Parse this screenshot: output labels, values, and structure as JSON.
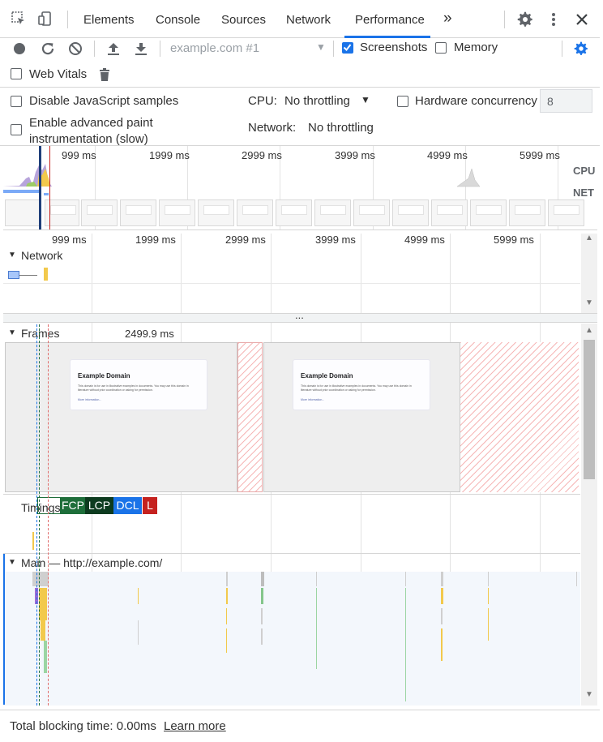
{
  "tabs": {
    "elements": "Elements",
    "console": "Console",
    "sources": "Sources",
    "network": "Network",
    "performance": "Performance",
    "more": "»"
  },
  "toolbar": {
    "recording_select": "example.com #1",
    "screenshots_label": "Screenshots",
    "screenshots_checked": true,
    "memory_label": "Memory",
    "memory_checked": false,
    "web_vitals_label": "Web Vitals",
    "web_vitals_checked": false
  },
  "settings": {
    "disable_js_samples_label": "Disable JavaScript samples",
    "advanced_paint_label_line1": "Enable advanced paint",
    "advanced_paint_label_line2": "instrumentation (slow)",
    "cpu_label": "CPU:",
    "cpu_value": "No throttling",
    "network_label": "Network:",
    "network_value": "No throttling",
    "hw_concurrency_label": "Hardware concurrency",
    "hw_concurrency_value": "8"
  },
  "overview": {
    "ticks": [
      "999 ms",
      "1999 ms",
      "2999 ms",
      "3999 ms",
      "4999 ms",
      "5999 ms"
    ],
    "cpu_label": "CPU",
    "net_label": "NET"
  },
  "timeline": {
    "ticks": [
      "999 ms",
      "1999 ms",
      "2999 ms",
      "3999 ms",
      "4999 ms",
      "5999 ms"
    ],
    "network_label": "Network",
    "frames_label": "Frames",
    "frame_duration": "2499.9 ms",
    "more_dots": "...",
    "timings_label": "Timings",
    "main_label": "Main — http://example.com/"
  },
  "screenshot_preview": {
    "title": "Example Domain",
    "body": "This domain is for use in illustrative examples in documents. You may use this domain in literature without prior coordination or asking for permission.",
    "link": "More information..."
  },
  "timings": {
    "fcp": "FCP",
    "lcp": "LCP",
    "dcl": "DCL",
    "l": "L",
    "colors": {
      "fcp": "#1e6e3a",
      "lcp": "#0d3b1f",
      "dcl": "#1a73e8",
      "l": "#c5221f"
    }
  },
  "footer": {
    "tbt": "Total blocking time: 0.00ms",
    "learn_more": "Learn more"
  }
}
